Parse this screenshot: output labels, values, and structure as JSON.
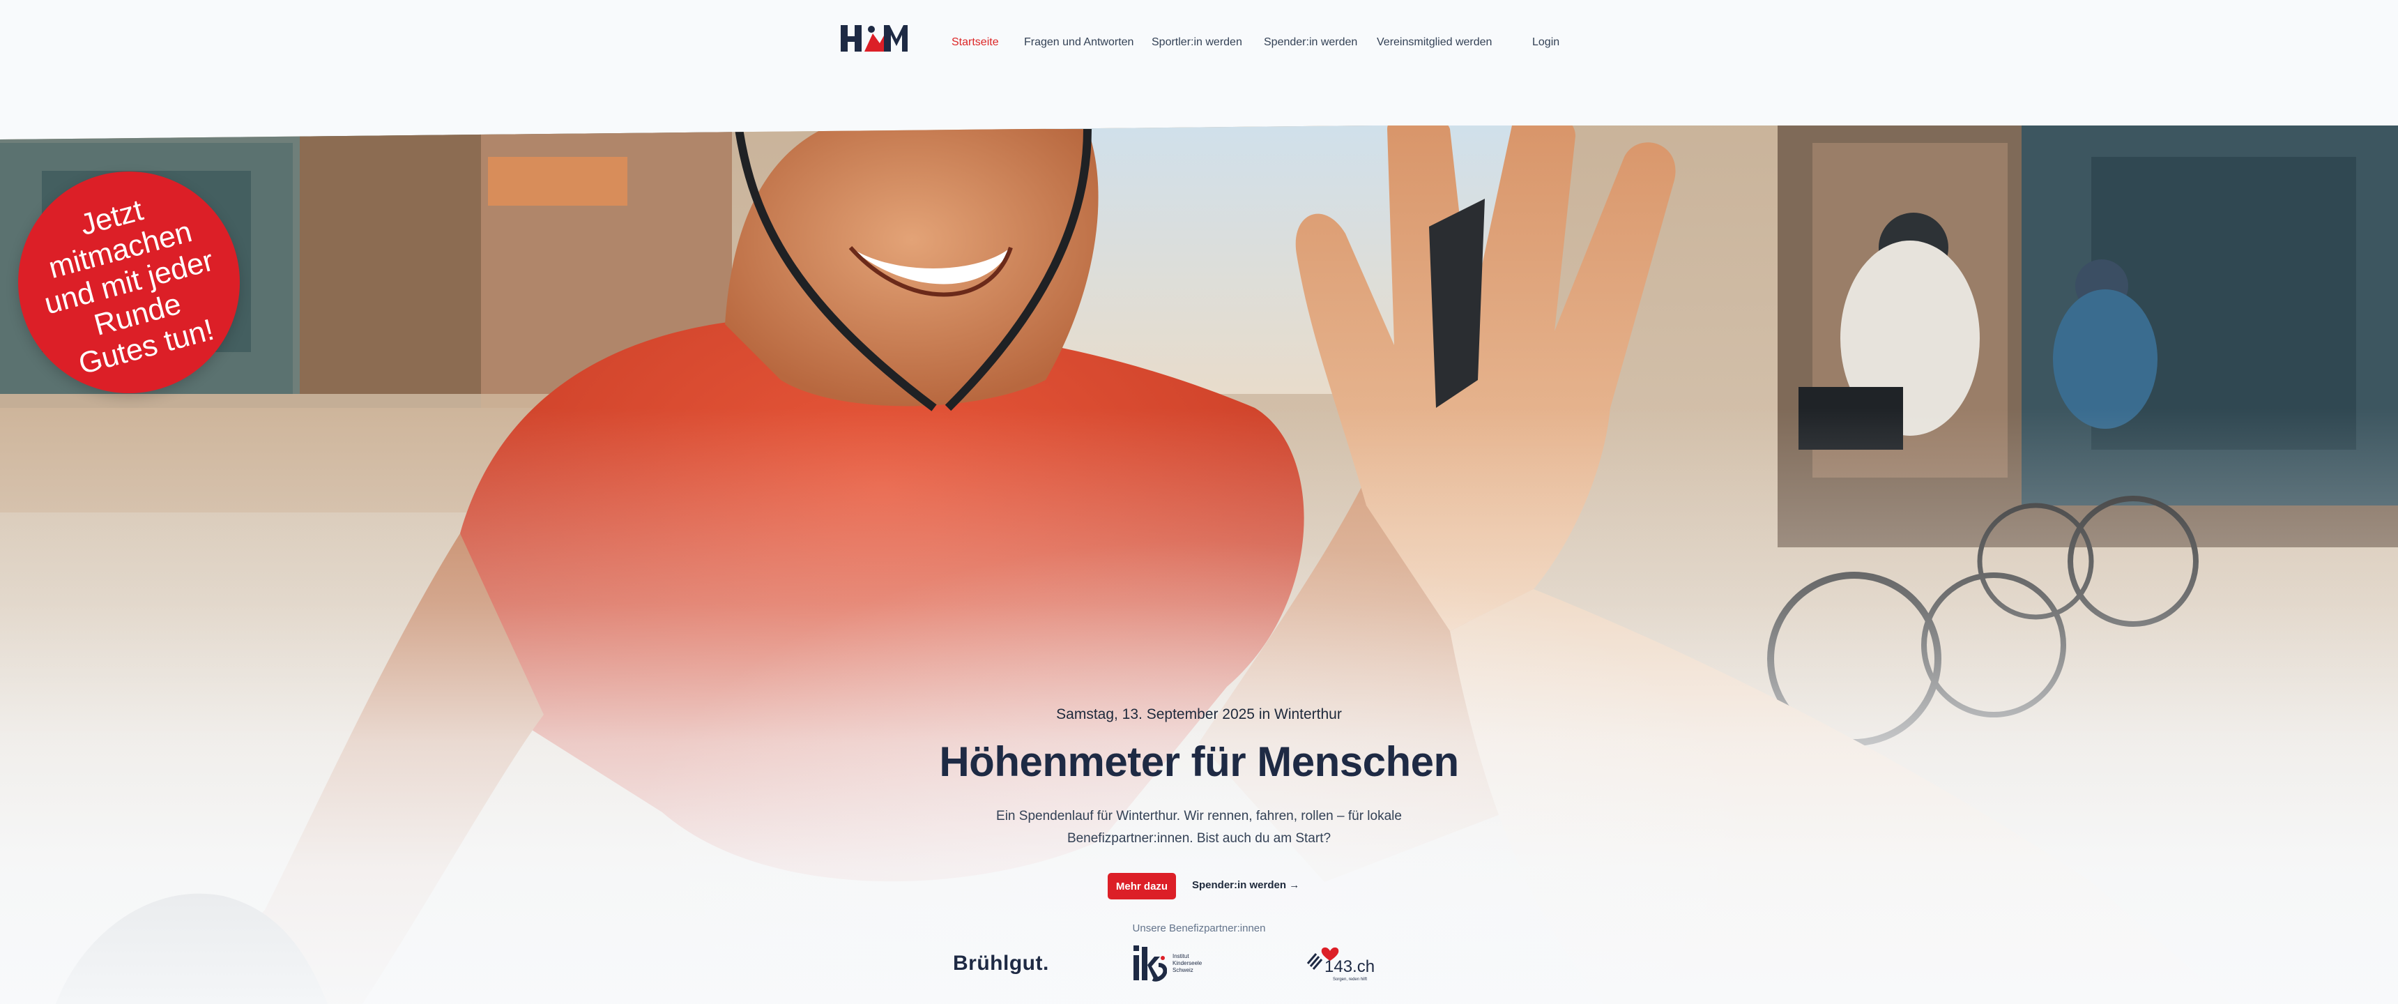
{
  "header": {
    "logo_text": "HöM",
    "nav": [
      {
        "label": "Startseite",
        "active": true
      },
      {
        "label": "Fragen und Antworten",
        "active": false
      },
      {
        "label": "Sportler:in werden",
        "active": false
      },
      {
        "label": "Spender:in werden",
        "active": false
      },
      {
        "label": "Vereinsmitglied werden",
        "active": false
      }
    ],
    "login_label": "Login"
  },
  "badge": {
    "text": "Jetzt mitmachen und mit jeder Runde Gutes tun!"
  },
  "hero": {
    "date": "Samstag, 13. September 2025 in Winterthur",
    "title": "Höhenmeter für Menschen",
    "description": "Ein Spendenlauf für Winterthur. Wir rennen, fahren, rollen – für lokale Benefizpartner:innen. Bist auch du am Start?",
    "primary_cta": "Mehr dazu",
    "secondary_cta": "Spender:in werden →"
  },
  "partners": {
    "label": "Unsere Benefizpartner:innen",
    "items": [
      {
        "name": "Brühlgut."
      },
      {
        "name": "iks",
        "tagline": "Institut Kinderseele Schweiz"
      },
      {
        "name": "143.ch",
        "tagline": "Sorgen, reden hilft"
      }
    ]
  },
  "colors": {
    "accent": "#dc1f27",
    "navy": "#1e2a44",
    "background": "#f8fafc"
  }
}
